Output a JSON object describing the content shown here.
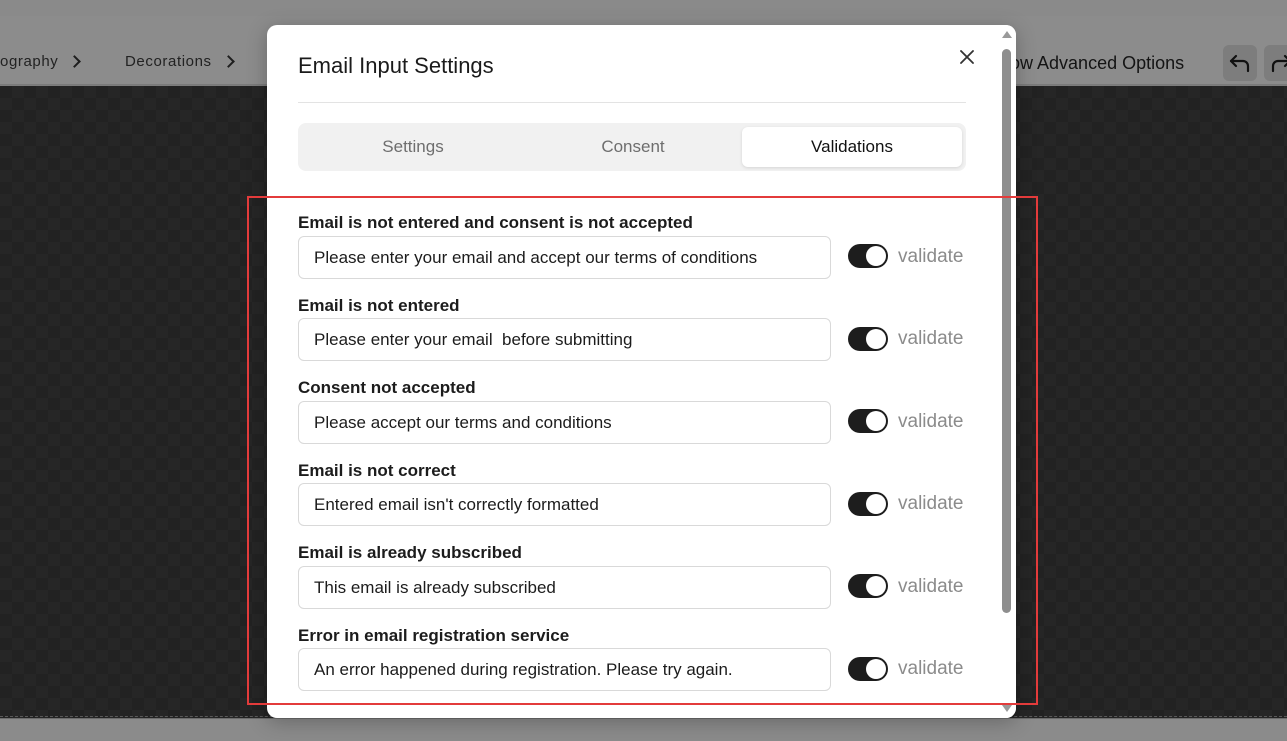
{
  "background": {
    "breadcrumbs": [
      "ography",
      "Decorations"
    ],
    "advanced_options_label": "how Advanced Options",
    "undo_icon": "undo-icon",
    "redo_icon": "redo-icon"
  },
  "modal": {
    "title": "Email Input Settings",
    "close_icon": "close-icon",
    "tabs": [
      {
        "label": "Settings",
        "active": false
      },
      {
        "label": "Consent",
        "active": false
      },
      {
        "label": "Validations",
        "active": true
      }
    ],
    "validations": [
      {
        "label": "Email is not entered and consent is not accepted",
        "value": "Please enter your email and accept our terms of conditions",
        "toggle_label": "validate",
        "enabled": true
      },
      {
        "label": "Email is not entered",
        "value": "Please enter your email  before submitting",
        "toggle_label": "validate",
        "enabled": true
      },
      {
        "label": "Consent not accepted",
        "value": "Please accept our terms and conditions",
        "toggle_label": "validate",
        "enabled": true
      },
      {
        "label": "Email is not correct",
        "value": "Entered email isn't correctly formatted",
        "toggle_label": "validate",
        "enabled": true
      },
      {
        "label": "Email is already subscribed",
        "value": "This email is already subscribed",
        "toggle_label": "validate",
        "enabled": true
      },
      {
        "label": "Error in email registration service",
        "value": "An error happened during registration. Please try again.",
        "toggle_label": "validate",
        "enabled": true
      }
    ]
  },
  "colors": {
    "highlight": "#e33b3b",
    "toggle_on": "#1d1d1d",
    "overlay": "#7d7d7d"
  }
}
